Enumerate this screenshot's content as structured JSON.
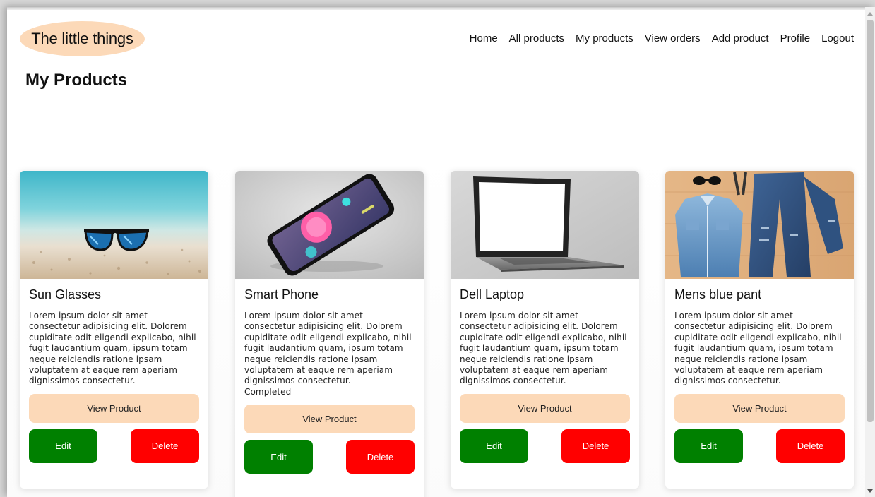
{
  "app": {
    "logo_text": "The little things"
  },
  "nav": {
    "items": [
      "Home",
      "All products",
      "My products",
      "View orders",
      "Add product",
      "Profile",
      "Logout"
    ]
  },
  "page": {
    "title": "My Products"
  },
  "products": [
    {
      "name": "Sun Glasses",
      "image": "sunglasses-on-beach",
      "description": "Lorem ipsum dolor sit amet consectetur adipisicing elit. Dolorem cupiditate odit eligendi explicabo, nihil fugit laudantium quam, ipsum totam neque reiciendis ratione ipsam voluptatem at eaque rem aperiam dignissimos consectetur.",
      "status": "",
      "view_label": "View Product",
      "edit_label": "Edit",
      "delete_label": "Delete"
    },
    {
      "name": "Smart Phone",
      "image": "smartphone-tilted",
      "description": "Lorem ipsum dolor sit amet consectetur adipisicing elit. Dolorem cupiditate odit eligendi explicabo, nihil fugit laudantium quam, ipsum totam neque reiciendis ratione ipsam voluptatem at eaque rem aperiam dignissimos consectetur.",
      "status": "Completed",
      "view_label": "View Product",
      "edit_label": "Edit",
      "delete_label": "Delete"
    },
    {
      "name": "Dell Laptop",
      "image": "laptop-blank-screen",
      "description": "Lorem ipsum dolor sit amet consectetur adipisicing elit. Dolorem cupiditate odit eligendi explicabo, nihil fugit laudantium quam, ipsum totam neque reiciendis ratione ipsam voluptatem at eaque rem aperiam dignissimos consectetur.",
      "status": "",
      "view_label": "View Product",
      "edit_label": "Edit",
      "delete_label": "Delete"
    },
    {
      "name": "Mens blue pant",
      "image": "denim-shirt-and-jeans",
      "description": "Lorem ipsum dolor sit amet consectetur adipisicing elit. Dolorem cupiditate odit eligendi explicabo, nihil fugit laudantium quam, ipsum totam neque reiciendis ratione ipsam voluptatem at eaque rem aperiam dignissimos consectetur.",
      "status": "",
      "view_label": "View Product",
      "edit_label": "Edit",
      "delete_label": "Delete"
    }
  ],
  "colors": {
    "accent_peach": "#fcd9b8",
    "edit_green": "#008000",
    "delete_red": "#ff0000"
  }
}
